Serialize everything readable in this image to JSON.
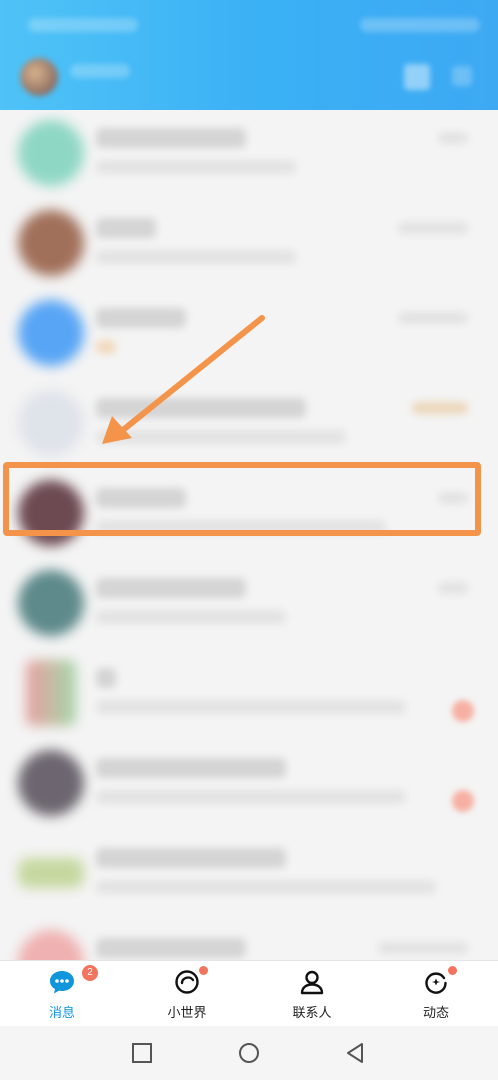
{
  "tabs": [
    {
      "label": "消息",
      "badge": "2",
      "active": true
    },
    {
      "label": "小世界",
      "dot": true
    },
    {
      "label": "联系人"
    },
    {
      "label": "动态",
      "dot": true
    }
  ],
  "colors": {
    "header": "#3ab0f5",
    "accent": "#1296db",
    "highlight": "#f4944a",
    "badge": "#f3735d"
  },
  "icons": {
    "tab_0": "chat-bubble-icon",
    "tab_1": "ring-icon",
    "tab_2": "person-icon",
    "tab_3": "star-refresh-icon",
    "nav": [
      "square-icon",
      "circle-icon",
      "triangle-back-icon"
    ]
  }
}
